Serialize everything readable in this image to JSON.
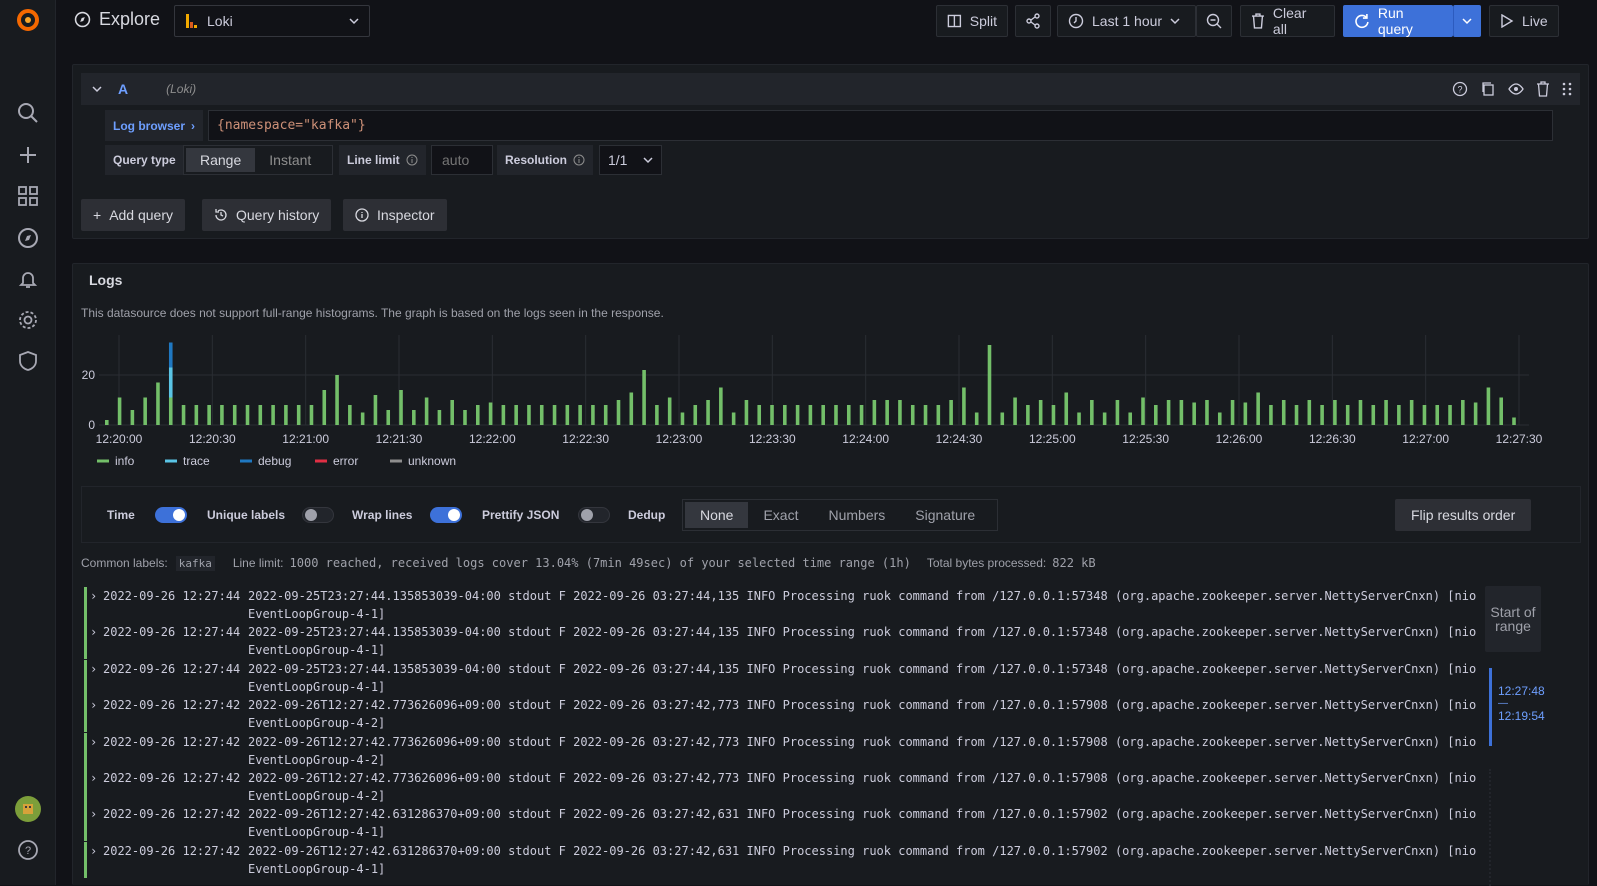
{
  "app": {
    "title": "Explore"
  },
  "datasource": {
    "name": "Loki"
  },
  "toolbar": {
    "split_label": "Split",
    "time_range_label": "Last 1 hour",
    "clear_all_label": "Clear all",
    "run_query_label": "Run query",
    "live_label": "Live"
  },
  "query": {
    "ref_id": "A",
    "datasource_hint": "(Loki)",
    "log_browser_label": "Log browser",
    "expression": "{namespace=\"kafka\"}",
    "query_type_label": "Query type",
    "query_type_options": [
      "Range",
      "Instant"
    ],
    "query_type_selected": "Range",
    "line_limit_label": "Line limit",
    "line_limit_placeholder": "auto",
    "resolution_label": "Resolution",
    "resolution_value": "1/1"
  },
  "actions": {
    "add_query": "Add query",
    "query_history": "Query history",
    "inspector": "Inspector"
  },
  "logs_panel": {
    "title": "Logs",
    "histogram_note": "This datasource does not support full-range histograms. The graph is based on the logs seen in the response."
  },
  "colors": {
    "info": "#73bf69",
    "trace": "#5ac4e5",
    "debug": "#1f78c1",
    "error": "#e02f44",
    "unknown": "#8e8e8e",
    "accent": "#3d71d9"
  },
  "chart_data": {
    "type": "bar",
    "stacked": true,
    "ylim": [
      0,
      36
    ],
    "yticks": [
      0,
      20
    ],
    "xticks": [
      "12:20:00",
      "12:20:30",
      "12:21:00",
      "12:21:30",
      "12:22:00",
      "12:22:30",
      "12:23:00",
      "12:23:30",
      "12:24:00",
      "12:24:30",
      "12:25:00",
      "12:25:30",
      "12:26:00",
      "12:26:30",
      "12:27:00",
      "12:27:30"
    ],
    "series": [
      {
        "name": "info",
        "color": "#73bf69",
        "values": [
          2,
          11,
          6,
          11,
          17,
          11,
          8,
          8,
          8,
          8,
          8,
          8,
          8,
          8,
          8,
          8,
          8,
          14,
          20,
          8,
          5,
          12,
          6,
          14,
          6,
          11,
          6,
          10,
          6,
          8,
          9,
          8,
          8,
          8,
          8,
          8,
          8,
          8,
          8,
          8,
          10,
          13,
          22,
          8,
          11,
          5,
          8,
          10,
          15,
          5,
          10,
          8,
          8,
          8,
          8,
          8,
          8,
          8,
          8,
          8,
          10,
          10,
          10,
          8,
          8,
          8,
          10,
          15,
          5,
          32,
          5,
          11,
          8,
          10,
          8,
          13,
          5,
          10,
          5,
          10,
          5,
          11,
          8,
          10,
          10,
          9,
          10,
          5,
          10,
          9,
          13,
          8,
          10,
          8,
          10,
          8,
          10,
          8,
          10,
          8,
          10,
          8,
          10,
          8,
          8,
          8,
          10,
          9,
          15,
          11,
          3
        ]
      },
      {
        "name": "trace",
        "color": "#5ac4e5",
        "values": [
          0,
          0,
          0,
          0,
          0,
          12,
          0,
          0,
          0,
          0,
          0,
          0,
          0,
          0,
          0,
          0,
          0,
          0,
          0,
          0,
          0,
          0,
          0,
          0,
          0,
          0,
          0,
          0,
          0,
          0,
          0,
          0,
          0,
          0,
          0,
          0,
          0,
          0,
          0,
          0,
          0,
          0,
          0,
          0,
          0,
          0,
          0,
          0,
          0,
          0,
          0,
          0,
          0,
          0,
          0,
          0,
          0,
          0,
          0,
          0,
          0,
          0,
          0,
          0,
          0,
          0,
          0,
          0,
          0,
          0,
          0,
          0,
          0,
          0,
          0,
          0,
          0,
          0,
          0,
          0,
          0,
          0,
          0,
          0,
          0,
          0,
          0,
          0,
          0,
          0,
          0,
          0,
          0,
          0,
          0,
          0,
          0,
          0,
          0,
          0,
          0,
          0,
          0,
          0,
          0,
          0,
          0,
          0,
          0,
          0,
          0
        ]
      },
      {
        "name": "debug",
        "color": "#1f78c1",
        "values": [
          0,
          0,
          0,
          0,
          0,
          10,
          0,
          0,
          0,
          0,
          0,
          0,
          0,
          0,
          0,
          0,
          0,
          0,
          0,
          0,
          0,
          0,
          0,
          0,
          0,
          0,
          0,
          0,
          0,
          0,
          0,
          0,
          0,
          0,
          0,
          0,
          0,
          0,
          0,
          0,
          0,
          0,
          0,
          0,
          0,
          0,
          0,
          0,
          0,
          0,
          0,
          0,
          0,
          0,
          0,
          0,
          0,
          0,
          0,
          0,
          0,
          0,
          0,
          0,
          0,
          0,
          0,
          0,
          0,
          0,
          0,
          0,
          0,
          0,
          0,
          0,
          0,
          0,
          0,
          0,
          0,
          0,
          0,
          0,
          0,
          0,
          0,
          0,
          0,
          0,
          0,
          0,
          0,
          0,
          0,
          0,
          0,
          0,
          0,
          0,
          0,
          0,
          0,
          0,
          0,
          0,
          0,
          0,
          0,
          0,
          0
        ]
      },
      {
        "name": "error",
        "color": "#e02f44",
        "values": [
          0,
          0,
          0,
          0,
          0,
          0,
          0,
          0,
          0,
          0,
          0,
          0,
          0,
          0,
          0,
          0,
          0,
          0,
          0,
          0,
          0,
          0,
          0,
          0,
          0,
          0,
          0,
          0,
          0,
          0,
          0,
          0,
          0,
          0,
          0,
          0,
          0,
          0,
          0,
          0,
          0,
          0,
          0,
          0,
          0,
          0,
          0,
          0,
          0,
          0,
          0,
          0,
          0,
          0,
          0,
          0,
          0,
          0,
          0,
          0,
          0,
          0,
          0,
          0,
          0,
          0,
          0,
          0,
          0,
          0,
          0,
          0,
          0,
          0,
          0,
          0,
          0,
          0,
          0,
          0,
          0,
          0,
          0,
          0,
          0,
          0,
          0,
          0,
          0,
          0,
          0,
          0,
          0,
          0,
          0,
          0,
          0,
          0,
          0,
          0,
          0,
          0,
          0,
          0,
          0,
          0,
          0,
          0,
          0,
          0,
          0
        ]
      },
      {
        "name": "unknown",
        "color": "#8e8e8e",
        "values": [
          0,
          0,
          0,
          0,
          0,
          0,
          0,
          0,
          0,
          0,
          0,
          0,
          0,
          0,
          0,
          0,
          0,
          0,
          0,
          0,
          0,
          0,
          0,
          0,
          0,
          0,
          0,
          0,
          0,
          0,
          0,
          0,
          0,
          0,
          0,
          0,
          0,
          0,
          0,
          0,
          0,
          0,
          0,
          0,
          0,
          0,
          0,
          0,
          0,
          0,
          0,
          0,
          0,
          0,
          0,
          0,
          0,
          0,
          0,
          0,
          0,
          0,
          0,
          0,
          0,
          0,
          0,
          0,
          0,
          0,
          0,
          0,
          0,
          0,
          0,
          0,
          0,
          0,
          0,
          0,
          0,
          0,
          0,
          0,
          0,
          0,
          0,
          0,
          0,
          0,
          0,
          0,
          0,
          0,
          0,
          0,
          0,
          0,
          0,
          0,
          0,
          0,
          0,
          0,
          0,
          0,
          0,
          0,
          0,
          0,
          0
        ]
      }
    ],
    "legend": [
      "info",
      "trace",
      "debug",
      "error",
      "unknown"
    ],
    "legend_position": "bottom-left",
    "grid": true
  },
  "options": {
    "time_label": "Time",
    "unique_labels_label": "Unique labels",
    "wrap_lines_label": "Wrap lines",
    "prettify_json_label": "Prettify JSON",
    "dedup_label": "Dedup",
    "dedup_options": [
      "None",
      "Exact",
      "Numbers",
      "Signature"
    ],
    "dedup_selected": "None",
    "flip_label": "Flip results order"
  },
  "meta": {
    "common_labels_label": "Common labels:",
    "common_labels_value": "kafka",
    "line_limit_label": "Line limit:",
    "line_limit_value": "1000 reached, received logs cover 13.04% (7min 49sec) of your selected time range (1h)",
    "bytes_label": "Total bytes processed:",
    "bytes_value": "822 kB"
  },
  "log_rows": [
    {
      "ts": "2022-09-26 12:27:44",
      "line1": "2022-09-25T23:27:44.135853039-04:00 stdout F 2022-09-26 03:27:44,135 INFO Processing ruok command from /127.0.0.1:57348 (org.apache.zookeeper.server.NettyServerCnxn) [nio",
      "line2": "EventLoopGroup-4-1]"
    },
    {
      "ts": "2022-09-26 12:27:44",
      "line1": "2022-09-25T23:27:44.135853039-04:00 stdout F 2022-09-26 03:27:44,135 INFO Processing ruok command from /127.0.0.1:57348 (org.apache.zookeeper.server.NettyServerCnxn) [nio",
      "line2": "EventLoopGroup-4-1]"
    },
    {
      "ts": "2022-09-26 12:27:44",
      "line1": "2022-09-25T23:27:44.135853039-04:00 stdout F 2022-09-26 03:27:44,135 INFO Processing ruok command from /127.0.0.1:57348 (org.apache.zookeeper.server.NettyServerCnxn) [nio",
      "line2": "EventLoopGroup-4-1]"
    },
    {
      "ts": "2022-09-26 12:27:42",
      "line1": "2022-09-26T12:27:42.773626096+09:00 stdout F 2022-09-26 03:27:42,773 INFO Processing ruok command from /127.0.0.1:57908 (org.apache.zookeeper.server.NettyServerCnxn) [nio",
      "line2": "EventLoopGroup-4-2]"
    },
    {
      "ts": "2022-09-26 12:27:42",
      "line1": "2022-09-26T12:27:42.773626096+09:00 stdout F 2022-09-26 03:27:42,773 INFO Processing ruok command from /127.0.0.1:57908 (org.apache.zookeeper.server.NettyServerCnxn) [nio",
      "line2": "EventLoopGroup-4-2]"
    },
    {
      "ts": "2022-09-26 12:27:42",
      "line1": "2022-09-26T12:27:42.773626096+09:00 stdout F 2022-09-26 03:27:42,773 INFO Processing ruok command from /127.0.0.1:57908 (org.apache.zookeeper.server.NettyServerCnxn) [nio",
      "line2": "EventLoopGroup-4-2]"
    },
    {
      "ts": "2022-09-26 12:27:42",
      "line1": "2022-09-26T12:27:42.631286370+09:00 stdout F 2022-09-26 03:27:42,631 INFO Processing ruok command from /127.0.0.1:57902 (org.apache.zookeeper.server.NettyServerCnxn) [nio",
      "line2": "EventLoopGroup-4-1]"
    },
    {
      "ts": "2022-09-26 12:27:42",
      "line1": "2022-09-26T12:27:42.631286370+09:00 stdout F 2022-09-26 03:27:42,631 INFO Processing ruok command from /127.0.0.1:57902 (org.apache.zookeeper.server.NettyServerCnxn) [nio",
      "line2": "EventLoopGroup-4-1]"
    }
  ],
  "navigator": {
    "start_label": "Start of range",
    "range_end": "12:27:48",
    "range_dash": "—",
    "range_start": "12:19:54"
  },
  "icons": [
    "grafana-logo-icon",
    "search-icon",
    "plus-icon",
    "dashboards-icon",
    "explore-icon",
    "bell-icon",
    "gear-icon",
    "shield-icon",
    "avatar",
    "help-icon"
  ]
}
